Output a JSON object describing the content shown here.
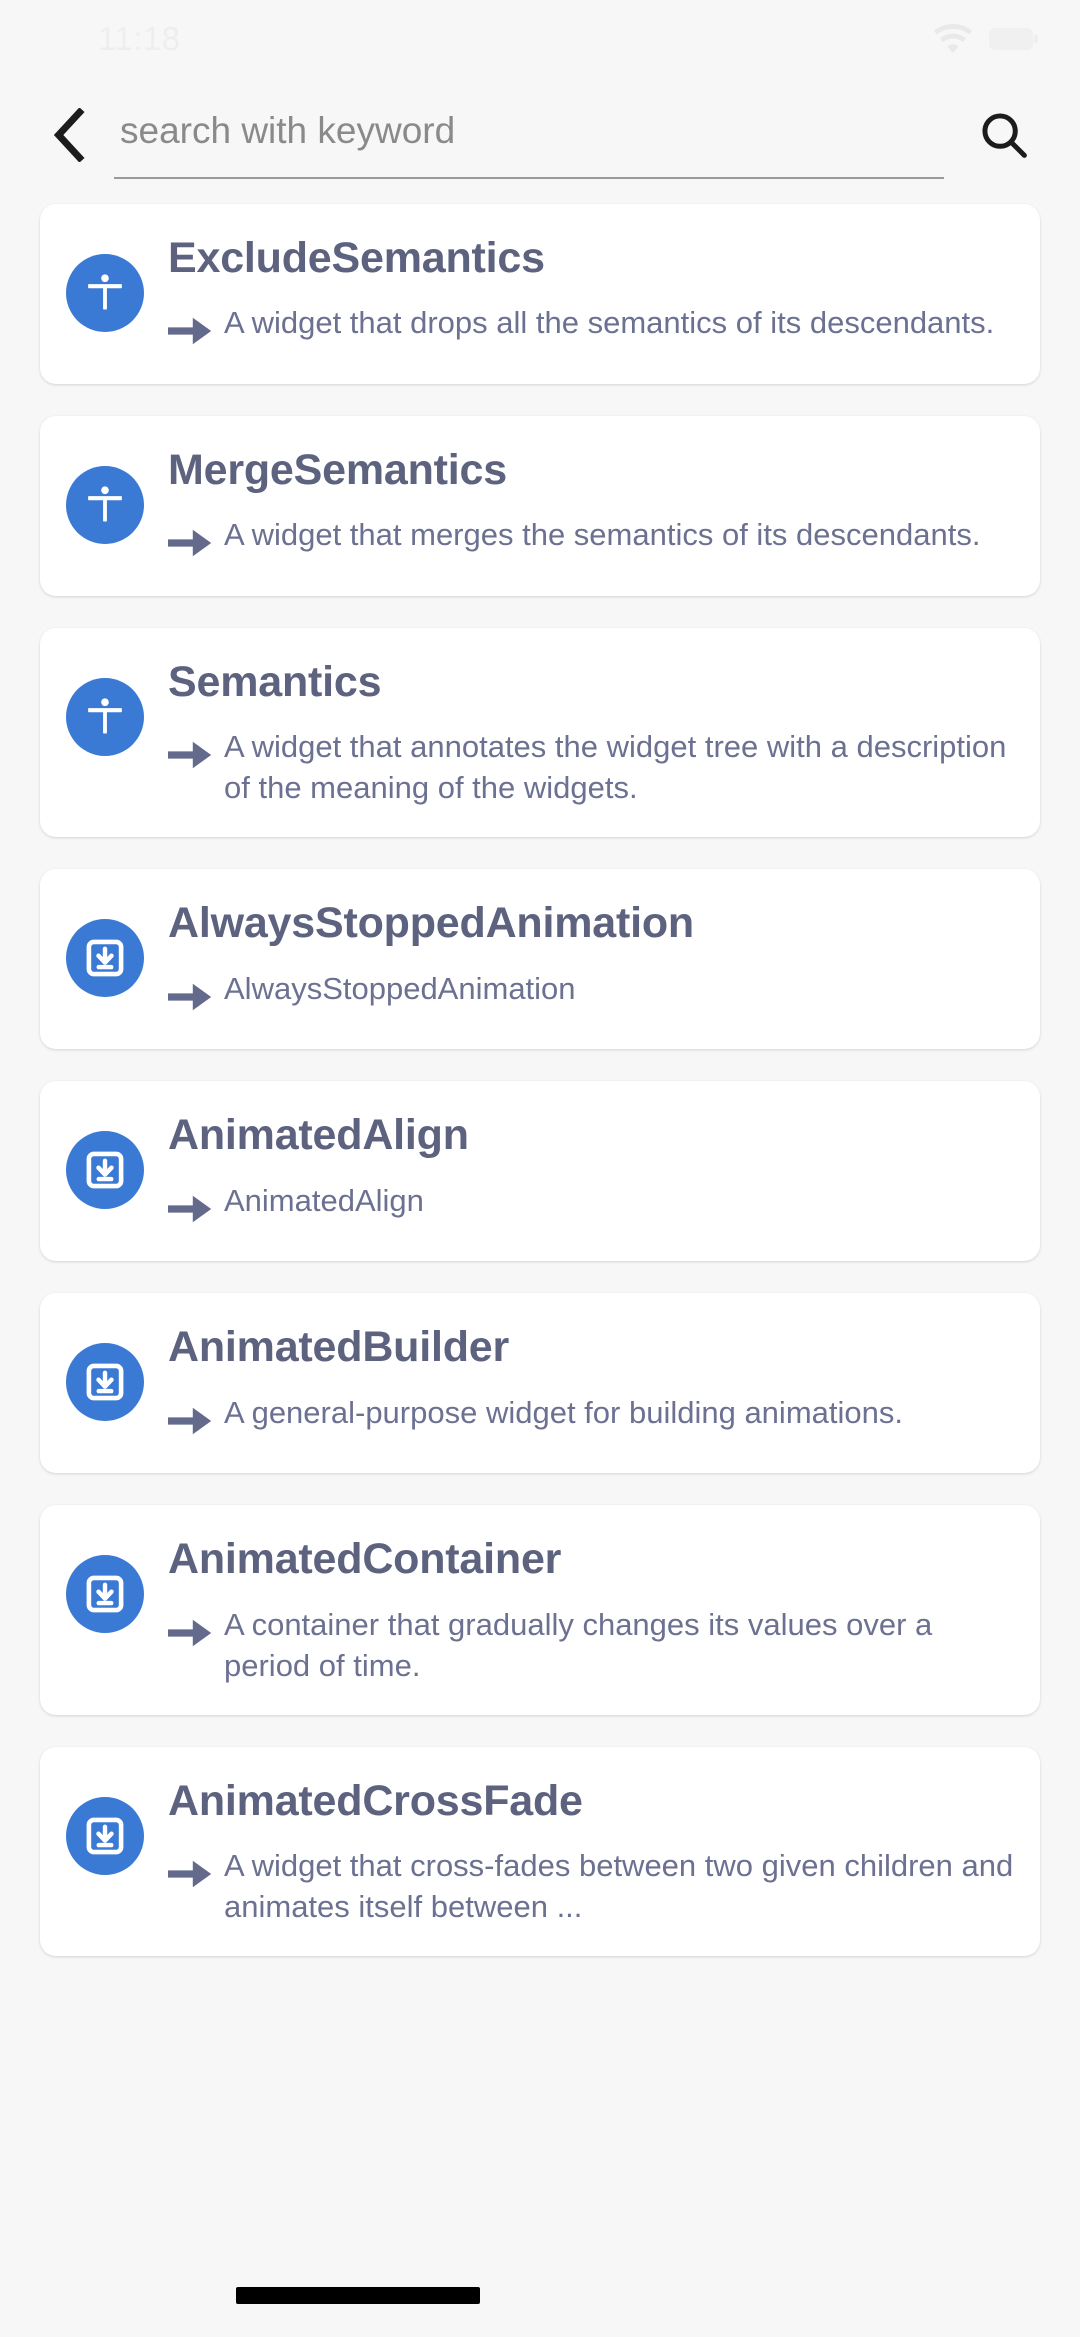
{
  "status_bar": {
    "time": "11:18",
    "wifi_icon": "wifi-icon",
    "battery_icon": "battery-icon"
  },
  "search": {
    "back_icon": "back-chevron-icon",
    "placeholder": "search with keyword",
    "value": "",
    "search_icon": "search-icon"
  },
  "colors": {
    "icon_blue": "#3b7ad4",
    "title_slate": "#5d627f",
    "desc_slate": "#6c7192",
    "page_bg": "#f7f7f7",
    "card_bg": "#ffffff",
    "underline": "#9a9a9a",
    "status_text": "#eeeeee"
  },
  "list": {
    "items": [
      {
        "icon": "accessibility-icon",
        "title": "ExcludeSemantics",
        "description": "A widget that drops all the semantics of its descendants.",
        "redacted": false
      },
      {
        "icon": "accessibility-icon",
        "title": "MergeSemantics",
        "description": "A widget that merges the semantics of its descendants.",
        "redacted": false
      },
      {
        "icon": "accessibility-icon",
        "title": "Semantics",
        "description": "A widget that annotates the widget tree with a description of the meaning of the widgets.",
        "redacted": false
      },
      {
        "icon": "download-box-icon",
        "title": "AlwaysStoppedAnimation",
        "description": "AlwaysStoppedAnimation",
        "redacted": false
      },
      {
        "icon": "download-box-icon",
        "title": "AnimatedAlign",
        "description": "AnimatedAlign",
        "redacted": false
      },
      {
        "icon": "download-box-icon",
        "title": "AnimatedBuilder",
        "description": "A general-purpose widget for building animations.",
        "redacted": false
      },
      {
        "icon": "download-box-icon",
        "title": "AnimatedContainer",
        "description": "A container that gradually changes its values over a period of time.",
        "redacted": false
      },
      {
        "icon": "download-box-icon",
        "title": "AnimatedCrossFade",
        "description": "A widget that cross-fades between two given children and animates itself between ...",
        "redacted": true
      }
    ]
  }
}
